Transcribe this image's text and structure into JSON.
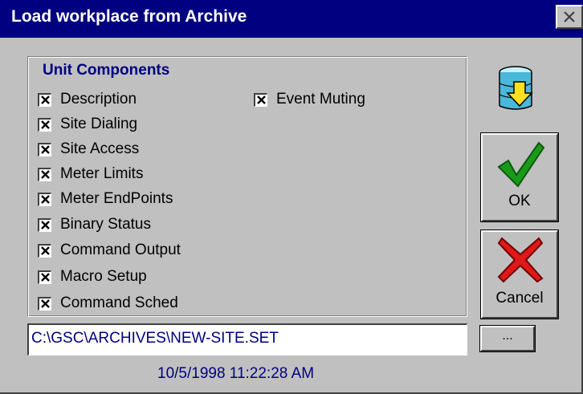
{
  "window": {
    "title": "Load workplace from Archive",
    "close_glyph": "×"
  },
  "group": {
    "title": "Unit Components",
    "items": [
      {
        "label": "Description",
        "checked": true
      },
      {
        "label": "Site Dialing",
        "checked": true
      },
      {
        "label": "Site Access",
        "checked": true
      },
      {
        "label": "Meter Limits",
        "checked": true
      },
      {
        "label": "Meter EndPoints",
        "checked": true
      },
      {
        "label": "Binary Status",
        "checked": true
      },
      {
        "label": "Command Output",
        "checked": true
      },
      {
        "label": "Macro Setup",
        "checked": true
      },
      {
        "label": "Command Sched",
        "checked": true
      },
      {
        "label": "Event Muting",
        "checked": true
      }
    ]
  },
  "buttons": {
    "ok_label": "OK",
    "cancel_label": "Cancel",
    "browse_label": "..."
  },
  "path": {
    "value": "C:\\GSC\\ARCHIVES\\NEW-SITE.SET"
  },
  "timestamp": "10/5/1998 11:22:28 AM",
  "icons": {
    "archive": "database-download-icon",
    "ok": "checkmark-icon",
    "cancel": "red-x-icon"
  },
  "colors": {
    "titlebar": "#000080",
    "face": "#c0c0c0",
    "accent_text": "#000080",
    "ok_green": "#1a9a1a",
    "cancel_red": "#e01818"
  }
}
